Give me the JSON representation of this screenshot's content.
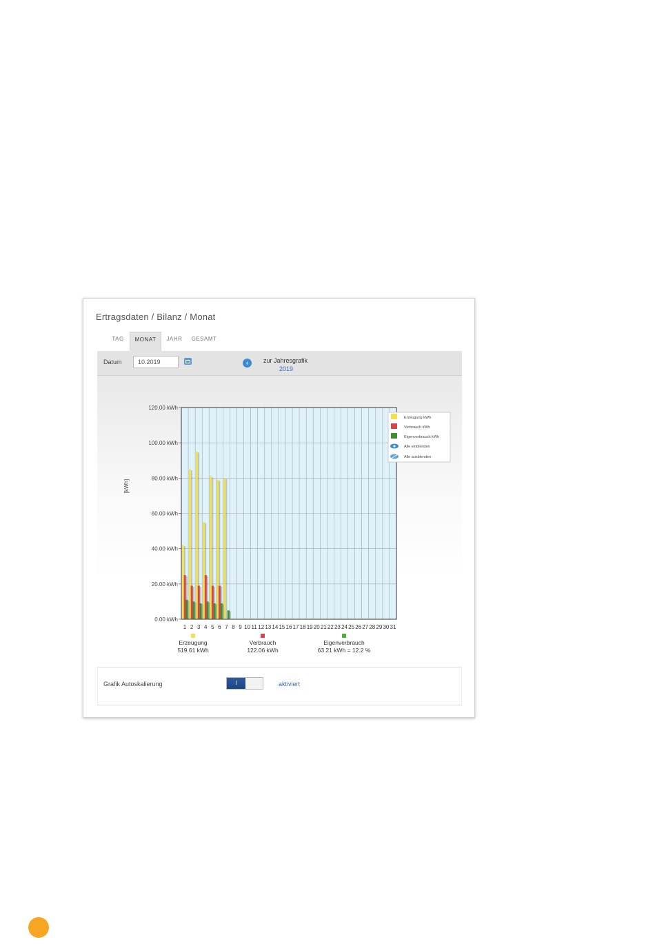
{
  "panel": {
    "title": "Ertragsdaten / Bilanz / Monat",
    "tabs": [
      {
        "label": "TAG",
        "active": false
      },
      {
        "label": "MONAT",
        "active": true
      },
      {
        "label": "JAHR",
        "active": false
      },
      {
        "label": "GESAMT",
        "active": false
      }
    ]
  },
  "toolbar": {
    "datum_label": "Datum",
    "date_value": "10.2019",
    "calendar_icon": "calendar-icon",
    "back_icon": "chevron-left-icon",
    "zur_label": "zur Jahresgrafik",
    "year_link": "2019"
  },
  "chart_data": {
    "type": "bar",
    "ylabel": "[kWh]",
    "ylim": [
      0,
      120
    ],
    "y_ticks": [
      "0.00 kWh",
      "20.00 kWh",
      "40.00 kWh",
      "60.00 kWh",
      "80.00 kWh",
      "100.00 kWh",
      "120.00 kWh"
    ],
    "categories": [
      "1",
      "2",
      "3",
      "4",
      "5",
      "6",
      "7",
      "8",
      "9",
      "10",
      "11",
      "12",
      "13",
      "14",
      "15",
      "16",
      "17",
      "18",
      "19",
      "20",
      "21",
      "22",
      "23",
      "24",
      "25",
      "26",
      "27",
      "28",
      "29",
      "30",
      "31"
    ],
    "grid": true,
    "plot_background": "#dff2fa",
    "legend_position": "right",
    "series": [
      {
        "name": "Erzeugung kWh",
        "color": "#f2e14c",
        "values": [
          42,
          85,
          95,
          55,
          81,
          79,
          80,
          0,
          0,
          0,
          0,
          0,
          0,
          0,
          0,
          0,
          0,
          0,
          0,
          0,
          0,
          0,
          0,
          0,
          0,
          0,
          0,
          0,
          0,
          0,
          0
        ]
      },
      {
        "name": "Verbrauch kWh",
        "color": "#d9434b",
        "values": [
          25,
          19,
          19,
          25,
          19,
          19,
          0,
          0,
          0,
          0,
          0,
          0,
          0,
          0,
          0,
          0,
          0,
          0,
          0,
          0,
          0,
          0,
          0,
          0,
          0,
          0,
          0,
          0,
          0,
          0,
          0
        ]
      },
      {
        "name": "Eigenverbrauch kWh",
        "color": "#3f8f2f",
        "values": [
          11,
          10,
          9,
          10,
          9,
          9,
          5,
          0,
          0,
          0,
          0,
          0,
          0,
          0,
          0,
          0,
          0,
          0,
          0,
          0,
          0,
          0,
          0,
          0,
          0,
          0,
          0,
          0,
          0,
          0,
          0
        ]
      }
    ],
    "legend_actions": [
      {
        "label": "Alle einblenden",
        "icon": "eye-icon"
      },
      {
        "label": "Alle ausblenden",
        "icon": "eye-hidden-icon"
      }
    ],
    "summary": [
      {
        "name": "Erzeugung",
        "value": "519.61 kWh",
        "color": "#f2e14c"
      },
      {
        "name": "Verbrauch",
        "value": "122.06 kWh",
        "color": "#d9434b"
      },
      {
        "name": "Eigenverbrauch",
        "value": "63.21 kWh = 12.2 %",
        "color": "#4caf3a"
      }
    ]
  },
  "footer": {
    "autoscale_label": "Grafik Autoskalierung",
    "toggle_on_label": "I",
    "status": "aktiviert"
  },
  "colors": {
    "page_marker": "#f6a623",
    "accent_blue": "#3a6fb0",
    "toggle_blue": "#1d4583"
  }
}
